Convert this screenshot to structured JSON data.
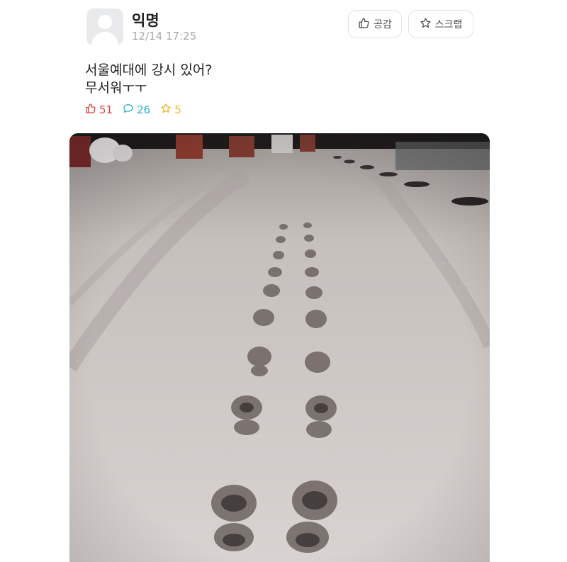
{
  "post": {
    "author": "익명",
    "timestamp": "12/14 17:25",
    "like_button_label": "공감",
    "scrap_button_label": "스크랩",
    "body_lines": [
      "서울예대에 강시 있어?",
      "무서워ㅜㅜ"
    ],
    "stats": {
      "likes": "51",
      "comments": "26",
      "scraps": "5"
    }
  },
  "colors": {
    "like": "#e0463f",
    "comment": "#2ab3c9",
    "scrap": "#e3b72b"
  },
  "icons": {
    "like": "thumbs-up-icon",
    "scrap": "star-icon",
    "comment": "speech-bubble-icon"
  }
}
